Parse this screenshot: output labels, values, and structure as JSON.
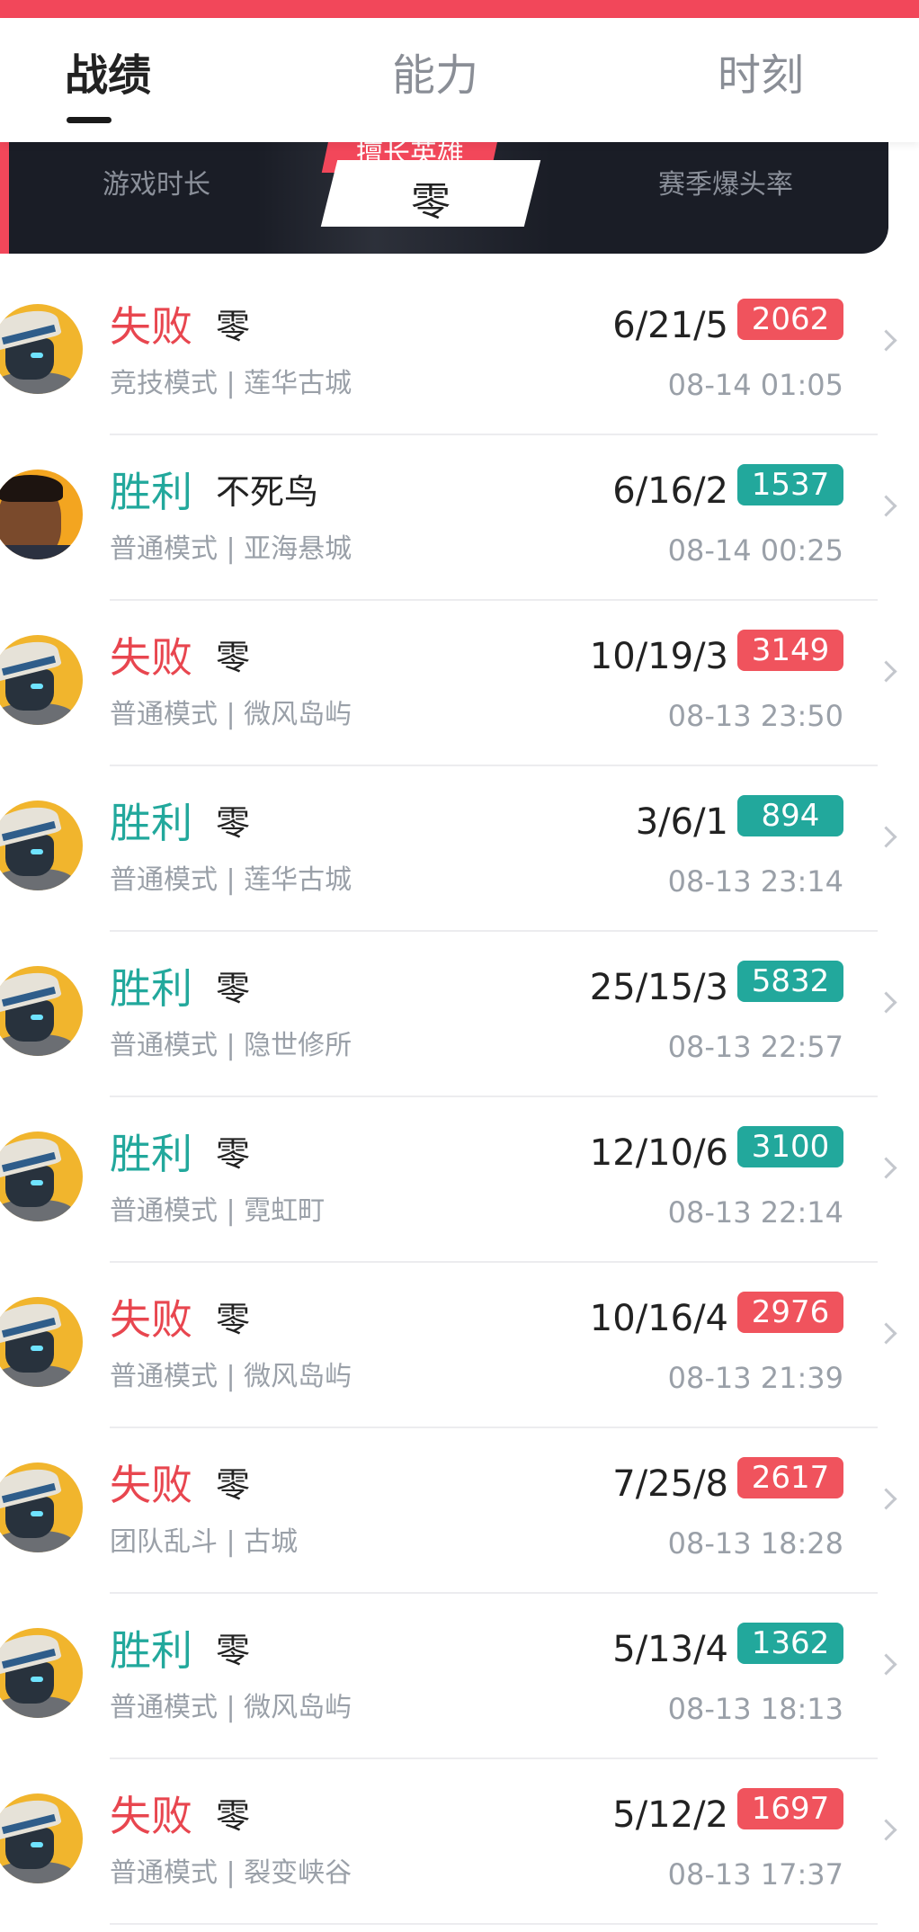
{
  "tabs": [
    {
      "label": "战绩",
      "active": true
    },
    {
      "label": "能力",
      "active": false
    },
    {
      "label": "时刻",
      "active": false
    }
  ],
  "summary": {
    "game_time_label": "游戏时长",
    "best_hero_tag": "擅长英雄",
    "best_hero_name": "零",
    "headshot_label": "赛季爆头率"
  },
  "matches": [
    {
      "result": "失败",
      "outcome": "lose",
      "hero": "零",
      "mode": "竞技模式 | 莲华古城",
      "kda": "6/21/5",
      "score": "2062",
      "time": "08-14 01:05",
      "avatar": "zero-avatar"
    },
    {
      "result": "胜利",
      "outcome": "win",
      "hero": "不死鸟",
      "mode": "普通模式 | 亚海悬城",
      "kda": "6/16/2",
      "score": "1537",
      "time": "08-14 00:25",
      "avatar": "phoenix-avatar"
    },
    {
      "result": "失败",
      "outcome": "lose",
      "hero": "零",
      "mode": "普通模式 | 微风岛屿",
      "kda": "10/19/3",
      "score": "3149",
      "time": "08-13 23:50",
      "avatar": "zero-avatar"
    },
    {
      "result": "胜利",
      "outcome": "win",
      "hero": "零",
      "mode": "普通模式 | 莲华古城",
      "kda": "3/6/1",
      "score": "894",
      "time": "08-13 23:14",
      "avatar": "zero-avatar"
    },
    {
      "result": "胜利",
      "outcome": "win",
      "hero": "零",
      "mode": "普通模式 | 隐世修所",
      "kda": "25/15/3",
      "score": "5832",
      "time": "08-13 22:57",
      "avatar": "zero-avatar"
    },
    {
      "result": "胜利",
      "outcome": "win",
      "hero": "零",
      "mode": "普通模式 | 霓虹町",
      "kda": "12/10/6",
      "score": "3100",
      "time": "08-13 22:14",
      "avatar": "zero-avatar"
    },
    {
      "result": "失败",
      "outcome": "lose",
      "hero": "零",
      "mode": "普通模式 | 微风岛屿",
      "kda": "10/16/4",
      "score": "2976",
      "time": "08-13 21:39",
      "avatar": "zero-avatar"
    },
    {
      "result": "失败",
      "outcome": "lose",
      "hero": "零",
      "mode": "团队乱斗 | 古城",
      "kda": "7/25/8",
      "score": "2617",
      "time": "08-13 18:28",
      "avatar": "zero-avatar"
    },
    {
      "result": "胜利",
      "outcome": "win",
      "hero": "零",
      "mode": "普通模式 | 微风岛屿",
      "kda": "5/13/4",
      "score": "1362",
      "time": "08-13 18:13",
      "avatar": "zero-avatar"
    },
    {
      "result": "失败",
      "outcome": "lose",
      "hero": "零",
      "mode": "普通模式 | 裂变峡谷",
      "kda": "5/12/2",
      "score": "1697",
      "time": "08-13 17:37",
      "avatar": "zero-avatar"
    }
  ],
  "colors": {
    "accent_red": "#f2475a",
    "lose": "#e8464f",
    "win": "#22a89c"
  }
}
